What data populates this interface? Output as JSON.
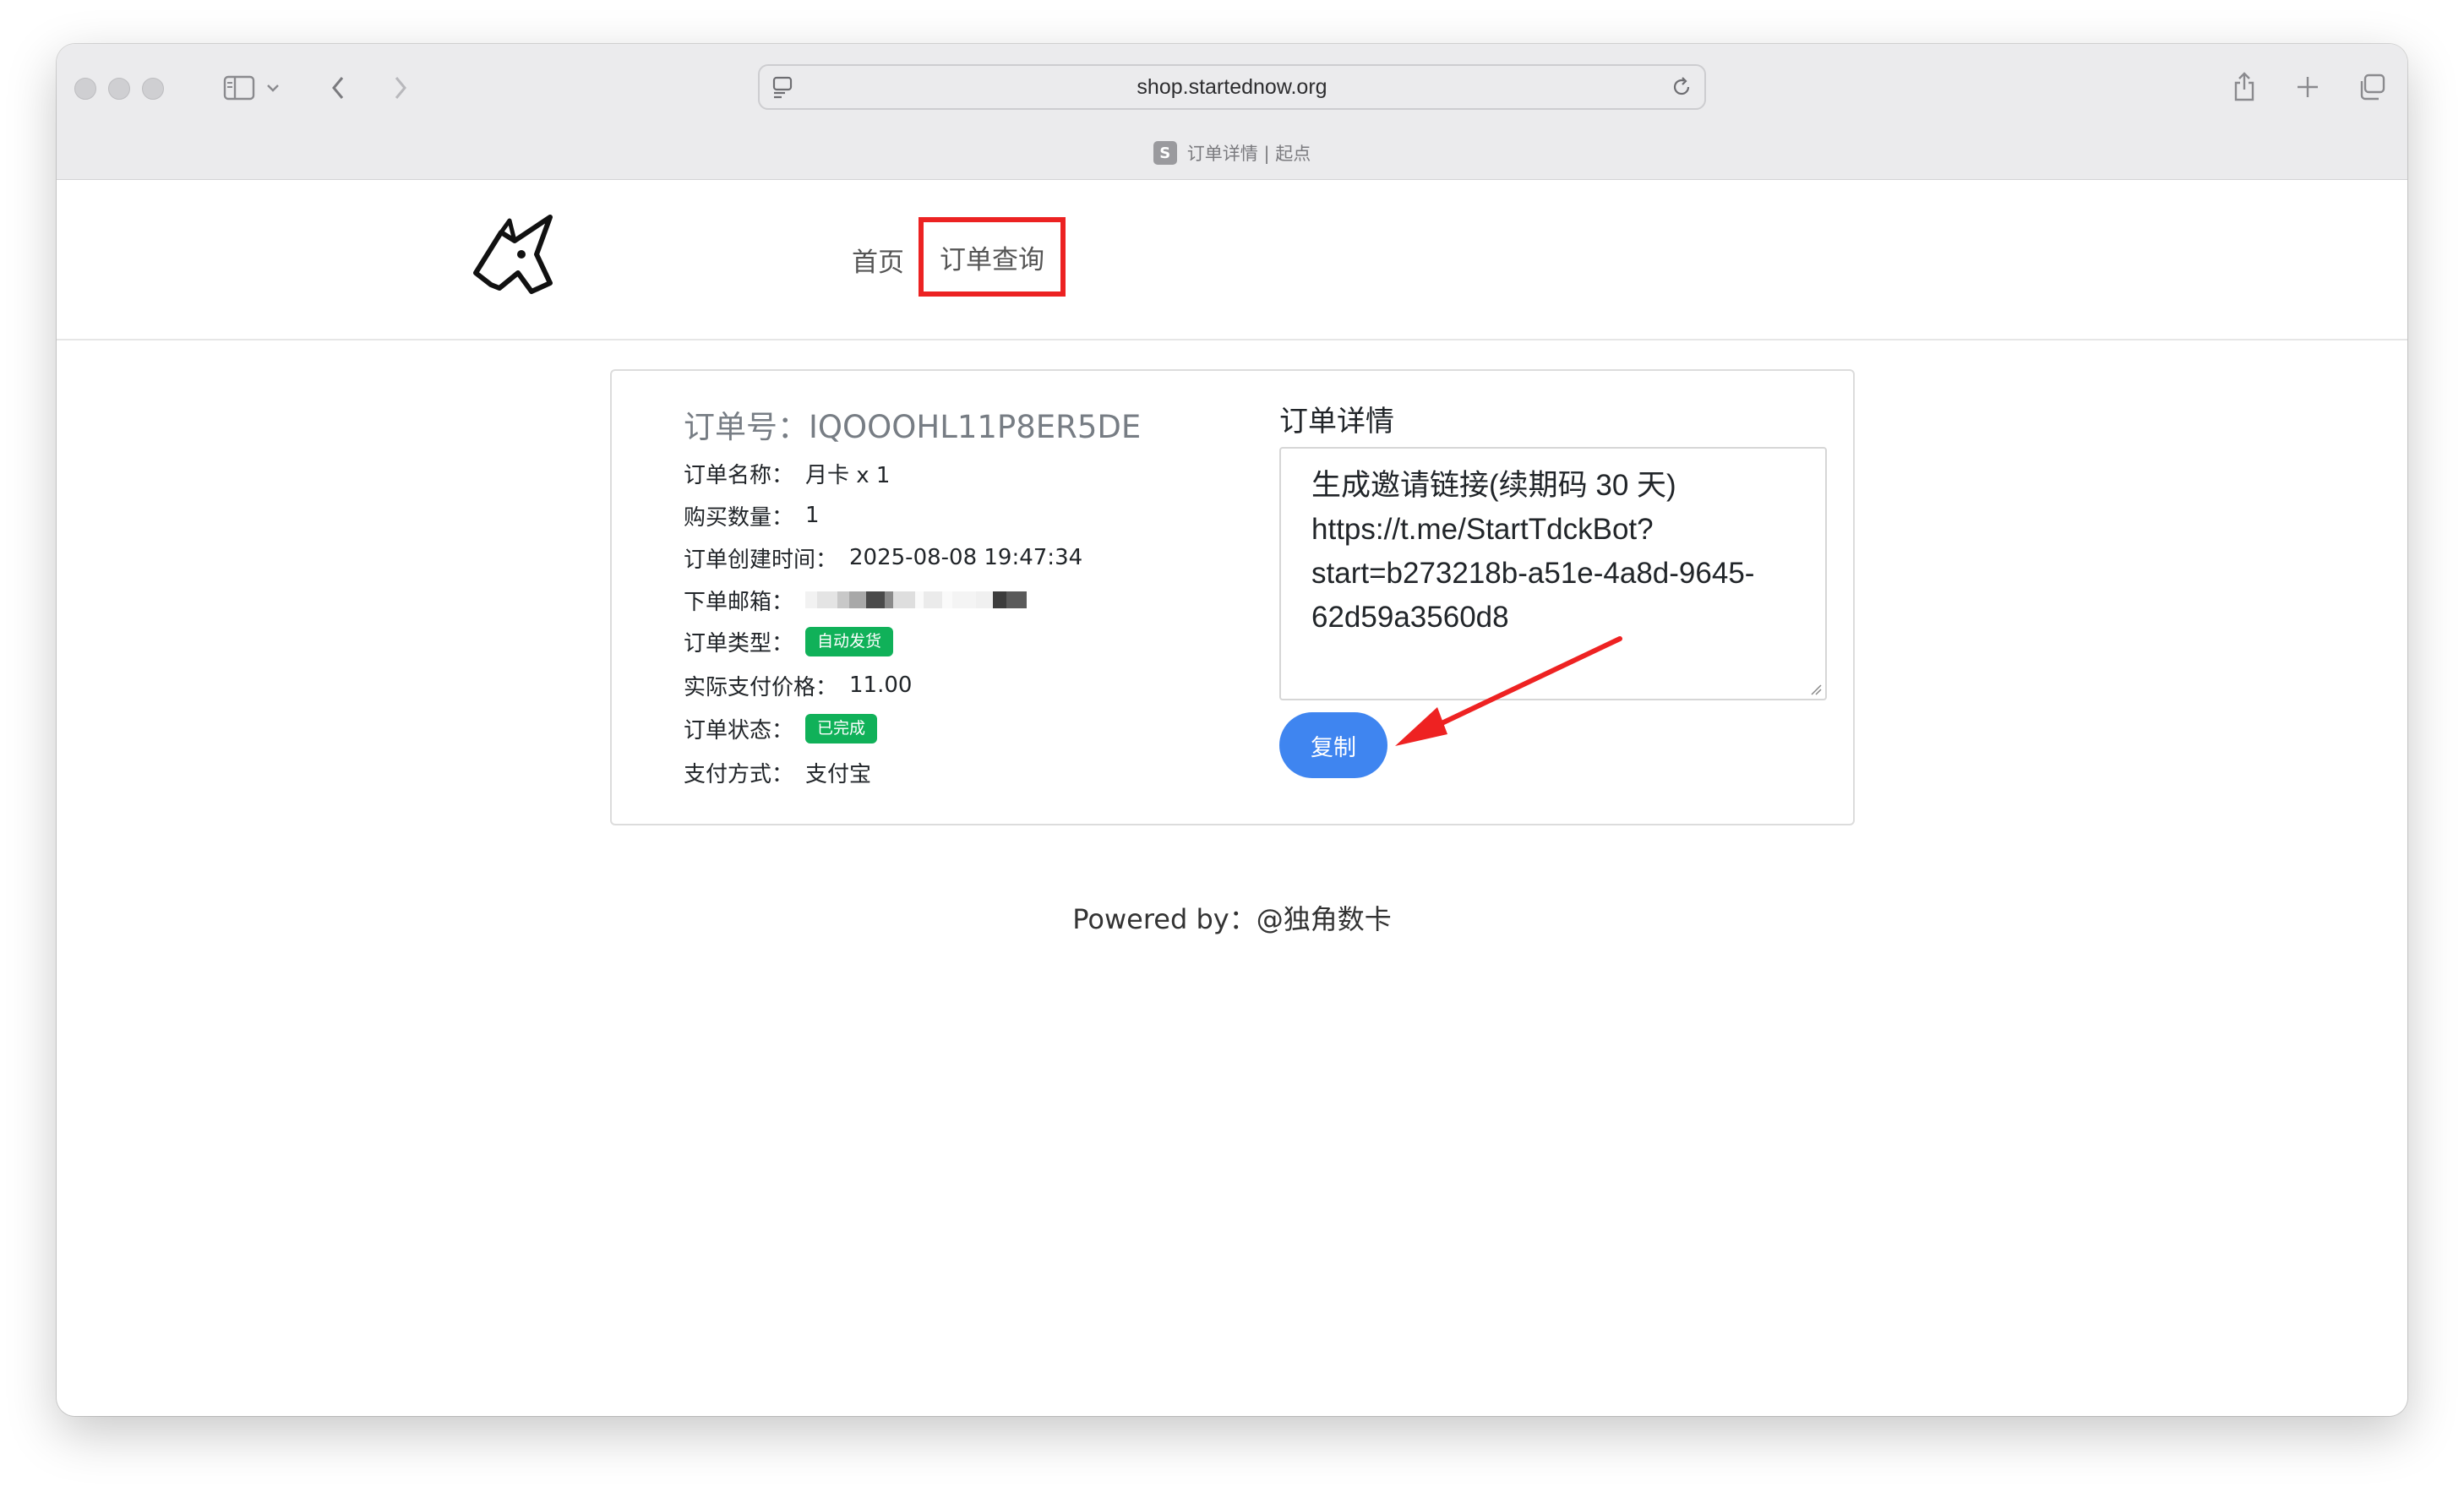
{
  "browser": {
    "url": "shop.startednow.org",
    "tab_title": "订单详情 | 起点",
    "favicon_letter": "S"
  },
  "nav": {
    "home": "首页",
    "orders": "订单查询"
  },
  "order": {
    "number_label": "订单号：",
    "number": "IQOOOHL11P8ER5DE",
    "name_label": "订单名称：",
    "name": "月卡 x 1",
    "quantity_label": "购买数量：",
    "quantity": "1",
    "created_label": "订单创建时间：",
    "created": "2025-08-08 19:47:34",
    "email_label": "下单邮箱：",
    "type_label": "订单类型：",
    "type": "自动发货",
    "price_label": "实际支付价格：",
    "price": "11.00",
    "status_label": "订单状态：",
    "status": "已完成",
    "payment_label": "支付方式：",
    "payment": "支付宝"
  },
  "details": {
    "title": "订单详情",
    "lines": [
      "生成邀请链接(续期码 30 天)",
      "https://t.me/StartTdckBot?",
      "start=b273218b-a51e-4a8d-9645-",
      "62d59a3560d8"
    ],
    "copy_label": "复制"
  },
  "footer": "Powered by：@独角数卡",
  "colors": {
    "badge_green": "#10b159",
    "copy_blue": "#3f85f0",
    "highlight_red": "#ec2222"
  }
}
